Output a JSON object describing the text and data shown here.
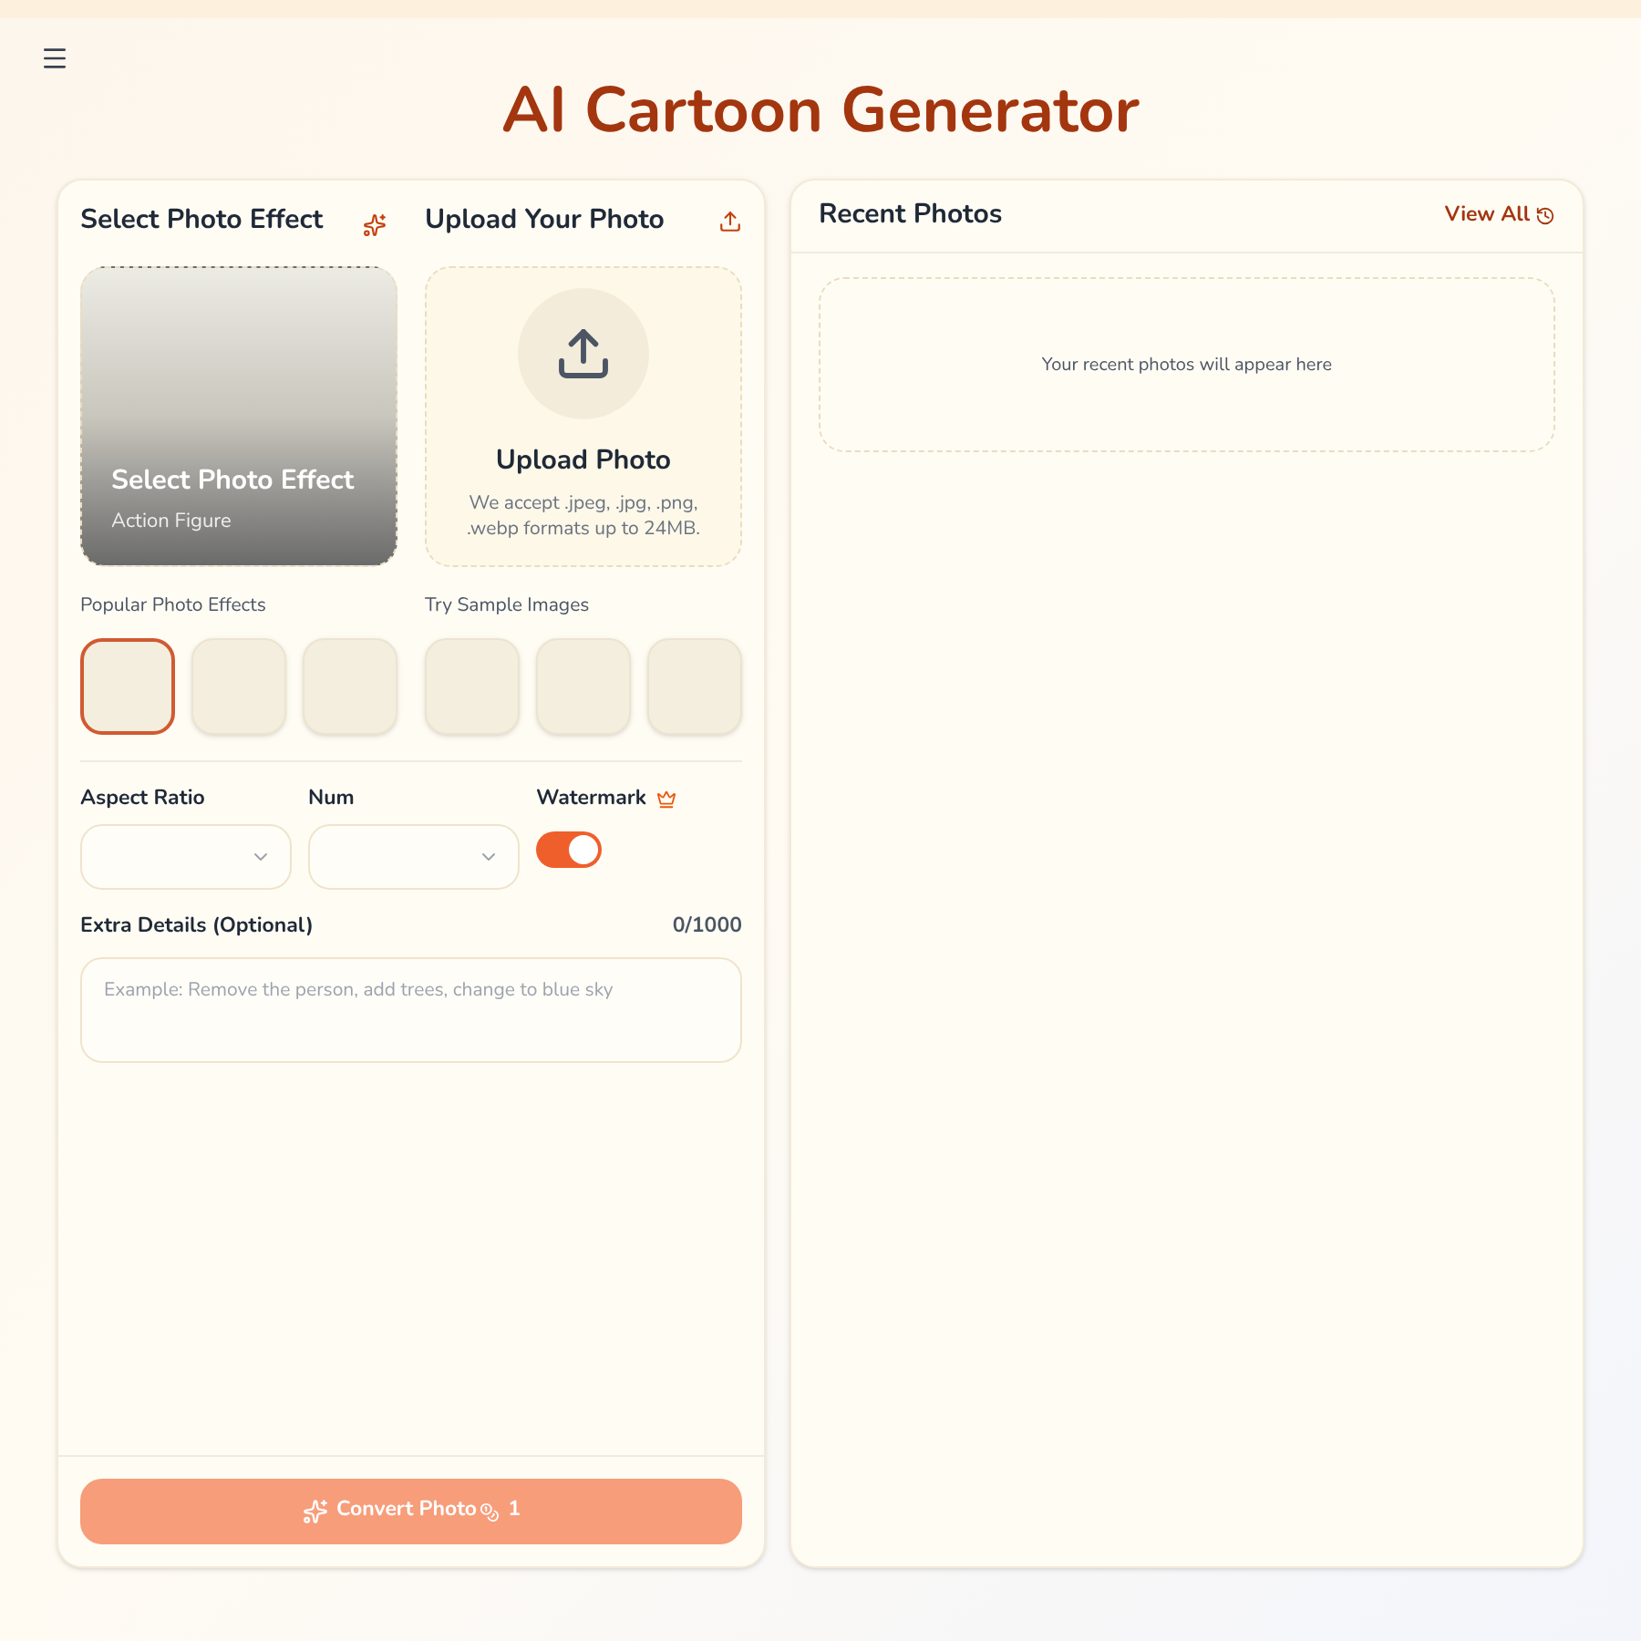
{
  "title": "AI Cartoon Generator",
  "effect_section": {
    "title": "Select Photo Effect",
    "preview_title": "Select Photo Effect",
    "preview_subtitle": "Action Figure"
  },
  "upload_section": {
    "title": "Upload Your Photo",
    "heading": "Upload Photo",
    "hint": "We accept .jpeg, .jpg, .png, .webp formats up to 24MB."
  },
  "popular_effects": {
    "label": "Popular Photo Effects",
    "items": [
      {
        "selected": true
      },
      {
        "selected": false
      },
      {
        "selected": false
      }
    ]
  },
  "sample_images": {
    "label": "Try Sample Images"
  },
  "aspect_ratio": {
    "label": "Aspect Ratio"
  },
  "num": {
    "label": "Num"
  },
  "watermark": {
    "label": "Watermark",
    "on": true
  },
  "extra_details": {
    "label": "Extra Details (Optional)",
    "counter": "0/1000",
    "placeholder": "Example: Remove the person, add trees, change to blue sky"
  },
  "convert_button": {
    "label": "Convert Photo",
    "cost": "1"
  },
  "recent": {
    "title": "Recent Photos",
    "view_all": "View All",
    "empty": "Your recent photos will appear here"
  }
}
